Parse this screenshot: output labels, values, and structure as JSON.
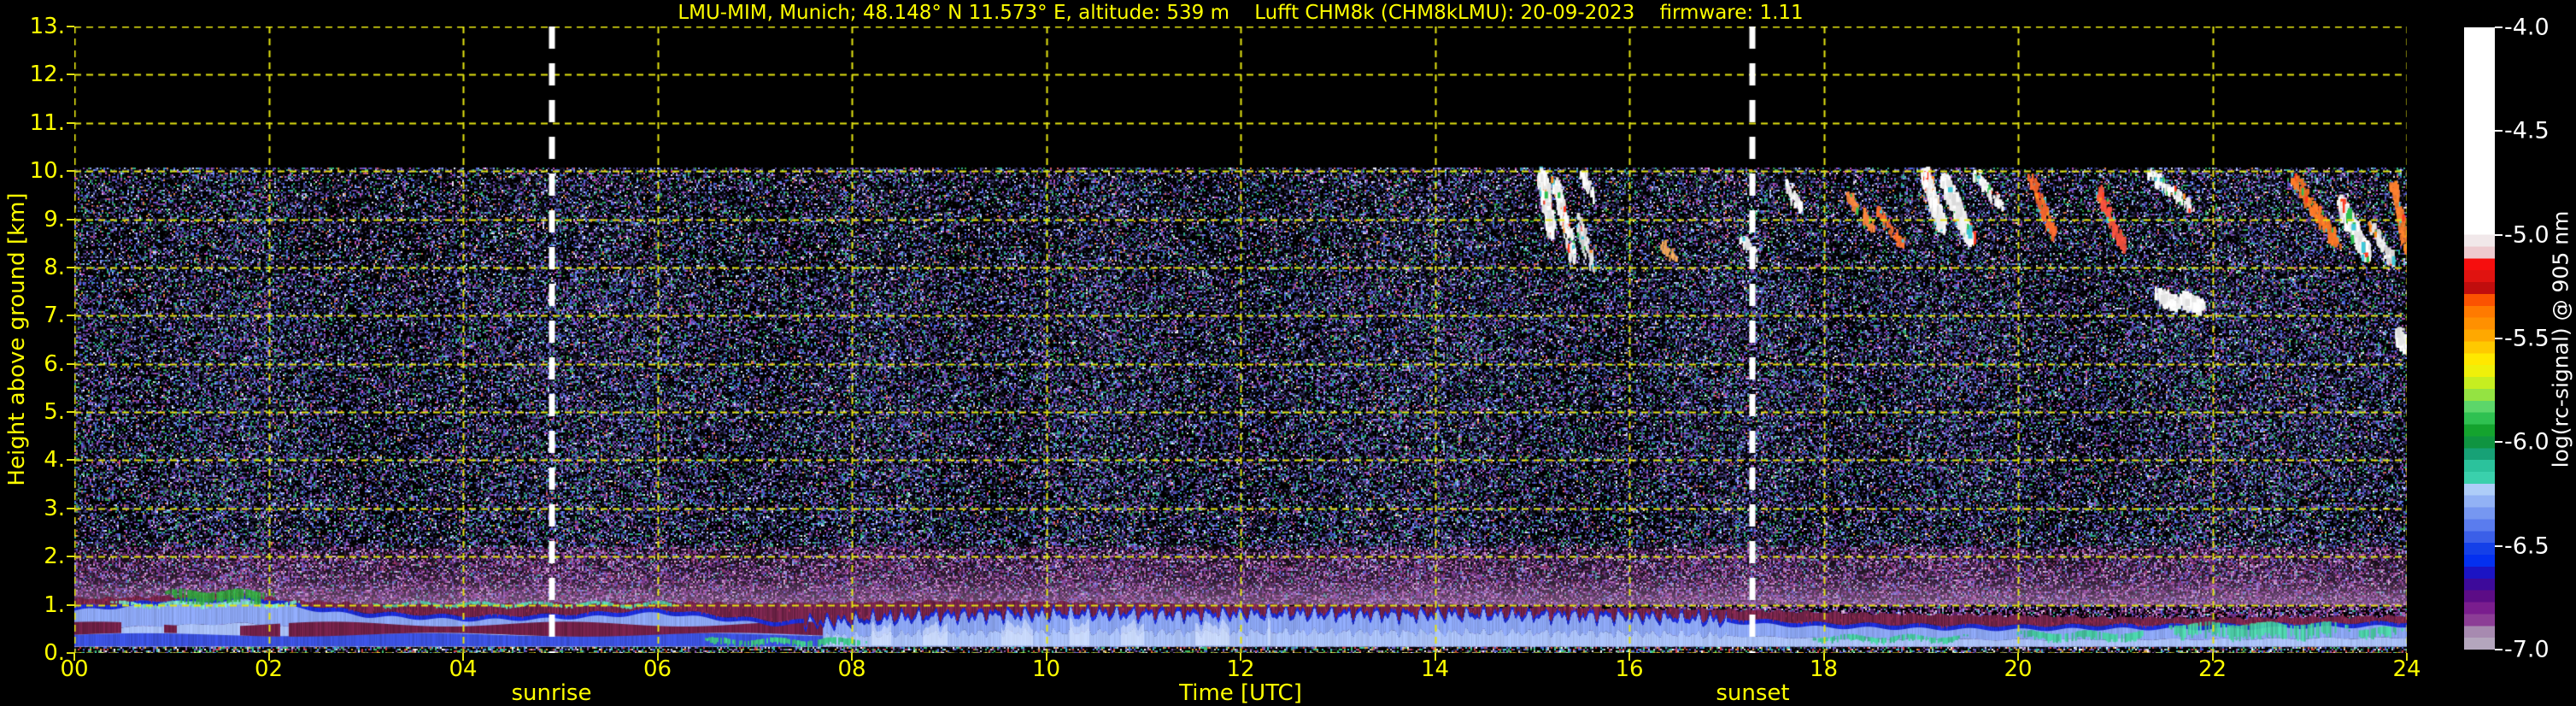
{
  "chart_data": {
    "type": "heatmap",
    "title": "LMU-MIM, Munich; 48.148° N 11.573° E, altitude: 539 m    Lufft CHM8k (CHM8kLMU): 20-09-2023    firmware: 1.11",
    "xlabel": "Time [UTC]",
    "ylabel": "Height above ground [km]",
    "x_range_hours": [
      0,
      24
    ],
    "y_range_km": [
      0,
      13
    ],
    "data_top_km": 10.08,
    "grid_color": "#e3e312",
    "title_color": "#ffff00",
    "axis_label_color": "#ffff00",
    "x_ticks": [
      {
        "label": "00",
        "hour": 0
      },
      {
        "label": "02",
        "hour": 2
      },
      {
        "label": "04",
        "hour": 4
      },
      {
        "label": "06",
        "hour": 6
      },
      {
        "label": "08",
        "hour": 8
      },
      {
        "label": "10",
        "hour": 10
      },
      {
        "label": "12",
        "hour": 12
      },
      {
        "label": "14",
        "hour": 14
      },
      {
        "label": "16",
        "hour": 16
      },
      {
        "label": "18",
        "hour": 18
      },
      {
        "label": "20",
        "hour": 20
      },
      {
        "label": "22",
        "hour": 22
      },
      {
        "label": "24",
        "hour": 24
      }
    ],
    "y_ticks": [
      {
        "label": "13.",
        "km": 13
      },
      {
        "label": "12.",
        "km": 12
      },
      {
        "label": "11.",
        "km": 11
      },
      {
        "label": "10.",
        "km": 10
      },
      {
        "label": "9.",
        "km": 9
      },
      {
        "label": "8.",
        "km": 8
      },
      {
        "label": "7.",
        "km": 7
      },
      {
        "label": "6.",
        "km": 6
      },
      {
        "label": "5.",
        "km": 5
      },
      {
        "label": "4.",
        "km": 4
      },
      {
        "label": "3.",
        "km": 3
      },
      {
        "label": "2.",
        "km": 2
      },
      {
        "label": "1.",
        "km": 1
      },
      {
        "label": "0.",
        "km": 0
      }
    ],
    "annotations": {
      "sunrise": {
        "label": "sunrise",
        "time_utc": 4.91,
        "line_color": "#ffffff"
      },
      "sunset": {
        "label": "sunset",
        "time_utc": 17.27,
        "line_color": "#ffffff"
      }
    },
    "colorbar": {
      "label": "log(rc-signal) @ 905 nm",
      "label_color": "#ffffff",
      "range_top_to_bottom": [
        -4.0,
        -7.0
      ],
      "white_fraction": 0.3333,
      "ticks": [
        {
          "label": "-4.0",
          "value": -4.0
        },
        {
          "label": "-4.5",
          "value": -4.5
        },
        {
          "label": "-5.0",
          "value": -5.0
        },
        {
          "label": "-5.5",
          "value": -5.5
        },
        {
          "label": "-6.0",
          "value": -6.0
        },
        {
          "label": "-6.5",
          "value": -6.5
        },
        {
          "label": "-7.0",
          "value": -7.0
        }
      ],
      "bands_top_to_bottom": [
        "#f1e8ea",
        "#eecacf",
        "#f60e0e",
        "#e01310",
        "#c00d0d",
        "#fb5301",
        "#ff7a00",
        "#ff9001",
        "#ffa800",
        "#ffc900",
        "#ffe800",
        "#eff00a",
        "#c6ee20",
        "#94e342",
        "#5cd66a",
        "#2fc151",
        "#14a32e",
        "#0f9441",
        "#17a176",
        "#2bc29c",
        "#3ad0ac",
        "#aecdf8",
        "#92b2f5",
        "#7697f1",
        "#5a7cee",
        "#3b5fe8",
        "#1440e8",
        "#0430f0",
        "#1b14c4",
        "#3d0a9a",
        "#5c0c86",
        "#7a1d8e",
        "#8c3d96",
        "#a78ab0",
        "#b4a6bd"
      ]
    },
    "boundary_layer": {
      "maroon_top_km": [
        [
          0,
          1.12
        ],
        [
          1,
          1.18
        ],
        [
          1.7,
          1.22
        ],
        [
          2.2,
          1.1
        ],
        [
          3,
          1.02
        ],
        [
          4,
          1.0
        ],
        [
          5,
          1.03
        ],
        [
          6,
          1.06
        ],
        [
          7,
          1.02
        ],
        [
          8,
          1.05
        ],
        [
          9,
          1.08
        ],
        [
          10,
          1.06
        ],
        [
          11,
          1.03
        ],
        [
          12,
          1.0
        ],
        [
          13,
          1.0
        ],
        [
          14,
          0.98
        ],
        [
          15,
          0.96
        ],
        [
          16,
          0.93
        ],
        [
          17,
          0.9
        ],
        [
          18,
          0.84
        ],
        [
          19,
          0.8
        ],
        [
          20,
          0.77
        ],
        [
          21,
          0.74
        ],
        [
          22,
          0.72
        ],
        [
          23,
          0.74
        ],
        [
          24,
          0.77
        ]
      ],
      "light_top_km": [
        [
          0,
          0.9
        ],
        [
          0.7,
          1.0
        ],
        [
          1.3,
          1.08
        ],
        [
          1.8,
          1.12
        ],
        [
          2.3,
          0.95
        ],
        [
          3,
          0.78
        ],
        [
          4,
          0.7
        ],
        [
          4.8,
          0.72
        ],
        [
          5.5,
          0.78
        ],
        [
          6,
          0.85
        ],
        [
          6.6,
          0.72
        ],
        [
          7.2,
          0.6
        ],
        [
          7.8,
          0.62
        ],
        [
          8.5,
          0.72
        ],
        [
          9.5,
          0.78
        ],
        [
          10.5,
          0.8
        ],
        [
          11.5,
          0.78
        ],
        [
          12.5,
          0.8
        ],
        [
          13.5,
          0.78
        ],
        [
          14.5,
          0.78
        ],
        [
          15.5,
          0.76
        ],
        [
          16.5,
          0.72
        ],
        [
          17.3,
          0.62
        ],
        [
          18,
          0.55
        ],
        [
          19,
          0.52
        ],
        [
          20,
          0.5
        ],
        [
          21,
          0.52
        ],
        [
          22,
          0.52
        ],
        [
          23,
          0.55
        ],
        [
          24,
          0.58
        ]
      ],
      "turret_hours_utc": [
        7.5,
        17.0
      ],
      "morning_band_until_utc": 7.7,
      "strip_top_km": 0.13,
      "colors": {
        "light_lower": "#a9c0f6",
        "light_upper": "#8aa4f0",
        "bright_patch": "rgba(225,236,255,0.55)",
        "dark_edge": "#1b2bd0",
        "maroon": "#6e2246",
        "maroon_speckle": "#a03050",
        "morning_blue": "#3a50dc",
        "morning_maroon": "#702047",
        "haze": "158,98,168",
        "haze2": "210,160,210"
      },
      "green_patches": [
        {
          "t": [
            0.3,
            2.4
          ],
          "h": [
            0.95,
            1.06
          ],
          "color": "#7adfc0"
        },
        {
          "t": [
            0.9,
            2.05
          ],
          "h": [
            1.0,
            1.3
          ],
          "color": "#2fa93a"
        },
        {
          "t": [
            3.0,
            6.3
          ],
          "h": [
            0.96,
            1.05
          ],
          "color": "#55d2b0"
        },
        {
          "t": [
            6.4,
            8.2
          ],
          "h": [
            0.14,
            0.3
          ],
          "color": "#3dbf8a"
        },
        {
          "t": [
            17.8,
            19.5
          ],
          "h": [
            0.22,
            0.36
          ],
          "color": "#3dc795"
        },
        {
          "t": [
            19.9,
            21.4
          ],
          "h": [
            0.24,
            0.44
          ],
          "color": "#3dc795"
        },
        {
          "t": [
            21.5,
            23.4
          ],
          "h": [
            0.26,
            0.62
          ],
          "color": "#44cf9c"
        },
        {
          "t": [
            23.4,
            24.0
          ],
          "h": [
            0.28,
            0.52
          ],
          "color": "#44cf9c"
        }
      ]
    },
    "clouds": [
      {
        "t": [
          15.08,
          15.18
        ],
        "h": [
          8.9,
          10.02
        ],
        "color": "#ffffff",
        "density": 0.85,
        "fringe": true,
        "thick": true
      },
      {
        "t": [
          15.22,
          15.42
        ],
        "h": [
          8.25,
          9.85
        ],
        "color": "#ffffff",
        "density": 0.7,
        "fringe": true,
        "thick": false
      },
      {
        "t": [
          15.45,
          15.6
        ],
        "h": [
          8.05,
          9.1
        ],
        "color": "#e8e8e8",
        "density": 0.35,
        "fringe": true,
        "thick": false
      },
      {
        "t": [
          15.5,
          15.62
        ],
        "h": [
          9.55,
          10.0
        ],
        "color": "#ffffff",
        "density": 0.5,
        "fringe": false,
        "thick": false
      },
      {
        "t": [
          16.33,
          16.45
        ],
        "h": [
          8.2,
          8.55
        ],
        "color": "#ffb060",
        "density": 0.3,
        "fringe": true,
        "thick": false
      },
      {
        "t": [
          17.15,
          17.28
        ],
        "h": [
          8.3,
          8.75
        ],
        "color": "#ffffff",
        "density": 0.4,
        "fringe": true,
        "thick": false
      },
      {
        "t": [
          17.62,
          17.75
        ],
        "h": [
          9.3,
          9.8
        ],
        "color": "#ffffff",
        "density": 0.6,
        "fringe": false,
        "thick": false
      },
      {
        "t": [
          18.25,
          18.5
        ],
        "h": [
          8.85,
          9.55
        ],
        "color": "#ff8840",
        "density": 0.5,
        "fringe": true,
        "thick": false
      },
      {
        "t": [
          18.55,
          18.8
        ],
        "h": [
          8.55,
          9.25
        ],
        "color": "#ff7030",
        "density": 0.45,
        "fringe": true,
        "thick": false
      },
      {
        "t": [
          19.02,
          19.2
        ],
        "h": [
          8.95,
          10.05
        ],
        "color": "#ffffff",
        "density": 0.95,
        "fringe": true,
        "thick": true
      },
      {
        "t": [
          19.22,
          19.5
        ],
        "h": [
          8.65,
          9.95
        ],
        "color": "#ffffff",
        "density": 0.8,
        "fringe": true,
        "thick": true
      },
      {
        "t": [
          19.55,
          19.8
        ],
        "h": [
          9.35,
          10.02
        ],
        "color": "#ffffff",
        "density": 0.6,
        "fringe": true,
        "thick": false
      },
      {
        "t": [
          20.12,
          20.35
        ],
        "h": [
          8.75,
          9.95
        ],
        "color": "#ff6a30",
        "density": 0.5,
        "fringe": true,
        "thick": false
      },
      {
        "t": [
          20.82,
          21.08
        ],
        "h": [
          8.45,
          9.65
        ],
        "color": "#ff5540",
        "density": 0.55,
        "fringe": true,
        "thick": false
      },
      {
        "t": [
          21.35,
          21.78
        ],
        "h": [
          9.3,
          10.0
        ],
        "color": "#ffffff",
        "density": 0.65,
        "fringe": true,
        "thick": false
      },
      {
        "t": [
          21.42,
          21.62
        ],
        "h": [
          7.32,
          7.55
        ],
        "color": "#ffffff",
        "density": 0.8,
        "fringe": false,
        "thick": true
      },
      {
        "t": [
          21.68,
          21.88
        ],
        "h": [
          7.28,
          7.45
        ],
        "color": "#ffffff",
        "density": 0.8,
        "fringe": false,
        "thick": true
      },
      {
        "t": [
          22.82,
          23.28
        ],
        "h": [
          8.55,
          9.95
        ],
        "color": "#ff7a28",
        "density": 0.7,
        "fringe": true,
        "thick": false
      },
      {
        "t": [
          23.3,
          23.58
        ],
        "h": [
          8.35,
          9.45
        ],
        "color": "#ffffff",
        "density": 0.75,
        "fringe": true,
        "thick": true
      },
      {
        "t": [
          23.6,
          23.85
        ],
        "h": [
          8.15,
          9.0
        ],
        "color": "#f0f0f0",
        "density": 0.5,
        "fringe": true,
        "thick": false
      },
      {
        "t": [
          23.85,
          24.0
        ],
        "h": [
          8.4,
          9.75
        ],
        "color": "#ff8030",
        "density": 0.6,
        "fringe": true,
        "thick": false
      },
      {
        "t": [
          23.88,
          24.0
        ],
        "h": [
          6.52,
          6.72
        ],
        "color": "#ffffff",
        "density": 0.85,
        "fringe": false,
        "thick": true
      }
    ],
    "noise_palettes": {
      "high": [
        [
          "#000000",
          0.46
        ],
        [
          "#16162c",
          0.08
        ],
        [
          "#2d2d58",
          0.07
        ],
        [
          "#3d3d7a",
          0.06
        ],
        [
          "#52449a",
          0.05
        ],
        [
          "#7a49b0",
          0.04
        ],
        [
          "#4a66e0",
          0.05
        ],
        [
          "#7f98ec",
          0.035
        ],
        [
          "#a8b8f0",
          0.02
        ],
        [
          "#2fae8c",
          0.045
        ],
        [
          "#2f9e3f",
          0.028
        ],
        [
          "#b44ab4",
          0.025
        ],
        [
          "#cf5a5a",
          0.014
        ],
        [
          "#e0873a",
          0.011
        ],
        [
          "#e8e8f0",
          0.012
        ],
        [
          "#d8c8e8",
          0.01
        ],
        [
          "#101018",
          0.1
        ]
      ],
      "mid": [
        [
          "#000000",
          0.4
        ],
        [
          "#191930",
          0.08
        ],
        [
          "#2e2e5e",
          0.08
        ],
        [
          "#3f3f80",
          0.07
        ],
        [
          "#5a3f9a",
          0.06
        ],
        [
          "#7a49b0",
          0.05
        ],
        [
          "#4a66e0",
          0.06
        ],
        [
          "#8098ec",
          0.04
        ],
        [
          "#b0bef2",
          0.02
        ],
        [
          "#2fae8c",
          0.05
        ],
        [
          "#37a347",
          0.03
        ],
        [
          "#b44ab4",
          0.03
        ],
        [
          "#d05858",
          0.012
        ],
        [
          "#e0a040",
          0.008
        ],
        [
          "#f0f0f0",
          0.01
        ],
        [
          "#0e0e16",
          0.1
        ]
      ],
      "low": [
        [
          "#000000",
          0.3
        ],
        [
          "#2a1538",
          0.1
        ],
        [
          "#4a2060",
          0.1
        ],
        [
          "#6e2e86",
          0.1
        ],
        [
          "#8d42a0",
          0.08
        ],
        [
          "#a85fb0",
          0.06
        ],
        [
          "#c07fc0",
          0.05
        ],
        [
          "#4a5fd8",
          0.06
        ],
        [
          "#8aa0ea",
          0.04
        ],
        [
          "#702048",
          0.06
        ],
        [
          "#9a3058",
          0.03
        ],
        [
          "#2fae8c",
          0.03
        ],
        [
          "#d8b0d8",
          0.04
        ],
        [
          "#e8d8e8",
          0.02
        ],
        [
          "#1a0f22",
          0.08
        ]
      ],
      "strip": [
        [
          "#000000",
          0.46
        ],
        [
          "#3dbf6a",
          0.06
        ],
        [
          "#d04040",
          0.05
        ],
        [
          "#4a62d8",
          0.07
        ],
        [
          "#c8c8d8",
          0.05
        ],
        [
          "#8855aa",
          0.06
        ],
        [
          "#e0a040",
          0.03
        ],
        [
          "#40c0c0",
          0.05
        ],
        [
          "#ffffff",
          0.02
        ],
        [
          "#202038",
          0.15
        ]
      ]
    },
    "fringe_colors": [
      "#ff3820",
      "#ff8c20",
      "#2fc050",
      "#40c8d8"
    ]
  }
}
